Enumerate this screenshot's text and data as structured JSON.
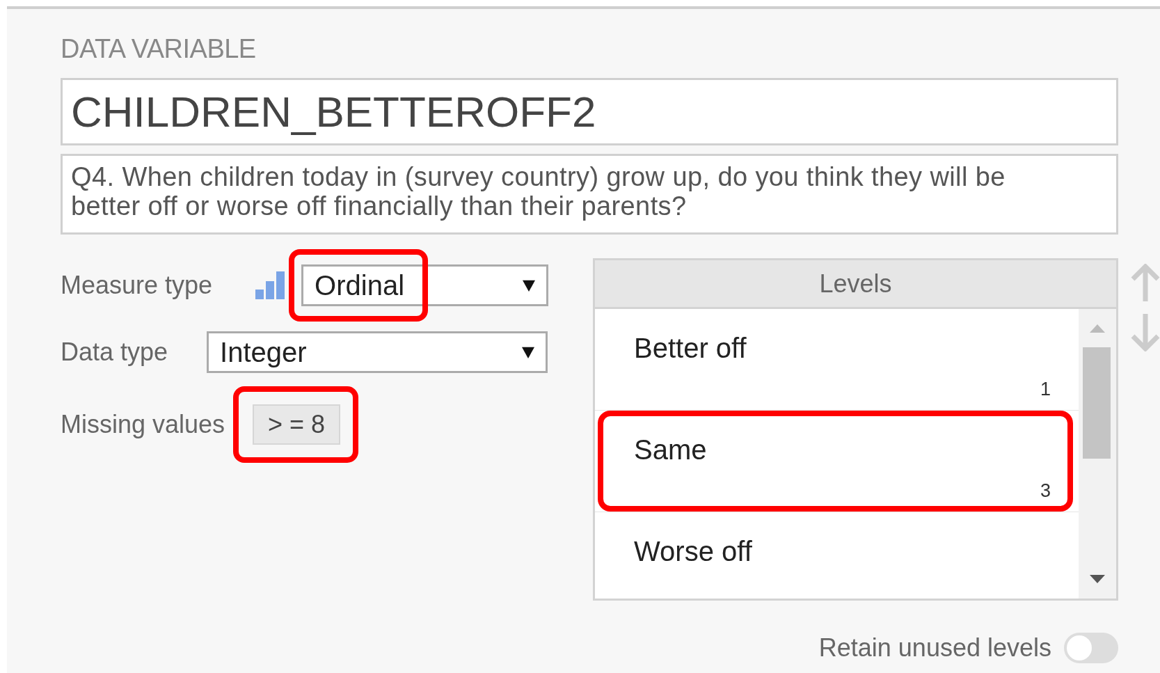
{
  "section_title": "DATA VARIABLE",
  "name": "CHILDREN_BETTEROFF2",
  "description": "Q4. When children today in (survey country) grow up, do you think they will be better off or worse off financially than their parents?",
  "measure_type": {
    "label": "Measure type",
    "value": "Ordinal",
    "highlighted": true
  },
  "data_type": {
    "label": "Data type",
    "value": "Integer"
  },
  "missing_values": {
    "label": "Missing values",
    "value": "> = 8",
    "highlighted": true
  },
  "levels": {
    "header": "Levels",
    "items": [
      {
        "label": "Better off",
        "code": "1",
        "highlighted": false
      },
      {
        "label": "Same",
        "code": "3",
        "highlighted": true
      },
      {
        "label": "Worse off",
        "highlighted": false
      }
    ]
  },
  "retain_unused_levels": {
    "label": "Retain unused levels",
    "on": false
  }
}
